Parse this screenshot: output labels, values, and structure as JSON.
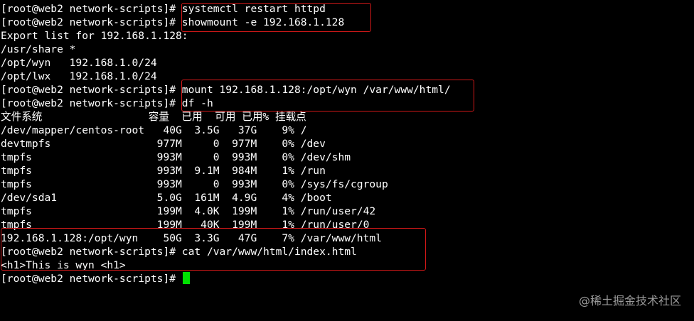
{
  "terminal": {
    "lines": [
      "[root@web2 network-scripts]# systemctl restart httpd",
      "[root@web2 network-scripts]# showmount -e 192.168.1.128",
      "Export list for 192.168.1.128:",
      "/usr/share *",
      "/opt/wyn   192.168.1.0/24",
      "/opt/lwx   192.168.1.0/24",
      "[root@web2 network-scripts]# mount 192.168.1.128:/opt/wyn /var/www/html/",
      "[root@web2 network-scripts]# df -h",
      "文件系统                 容量  已用  可用 已用% 挂载点",
      "/dev/mapper/centos-root   40G  3.5G   37G    9% /",
      "devtmpfs                 977M     0  977M    0% /dev",
      "tmpfs                    993M     0  993M    0% /dev/shm",
      "tmpfs                    993M  9.1M  984M    1% /run",
      "tmpfs                    993M     0  993M    0% /sys/fs/cgroup",
      "/dev/sda1                5.0G  161M  4.9G    4% /boot",
      "tmpfs                    199M  4.0K  199M    1% /run/user/42",
      "tmpfs                    199M   40K  199M    1% /run/user/0",
      "192.168.1.128:/opt/wyn    50G  3.3G   47G    7% /var/www/html",
      "[root@web2 network-scripts]# cat /var/www/html/index.html",
      "<h1>This is wyn <h1>",
      "[root@web2 network-scripts]# "
    ]
  },
  "watermark": "@稀土掘金技术社区",
  "colors": {
    "background": "#000000",
    "text": "#ffffff",
    "cursor": "#00e000",
    "highlight": "#d01818"
  }
}
